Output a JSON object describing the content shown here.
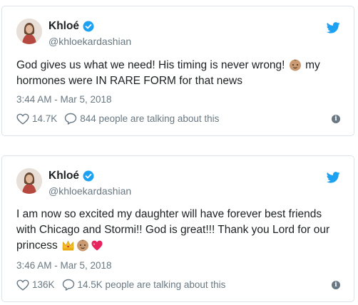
{
  "colors": {
    "verified_blue": "#1da1f2",
    "twitter_blue": "#1da1f2",
    "meta_gray": "#697882",
    "text": "#1c2022",
    "border": "#dde3e8"
  },
  "tweets": [
    {
      "display_name": "Khloé",
      "handle": "@khloekardashian",
      "text_parts": [
        "God gives us what we need! His timing is never wrong!",
        "my hormones were IN RARE FORM for that news"
      ],
      "emojis": [
        "baby-face-emoji"
      ],
      "timestamp": "3:44 AM - Mar 5, 2018",
      "likes": "14.7K",
      "talking": "844 people are talking about this"
    },
    {
      "display_name": "Khloé",
      "handle": "@khloekardashian",
      "text_parts": [
        "I am now so excited my daughter will have forever best friends with Chicago and Stormi!! God is great!!! Thank you Lord for our princess"
      ],
      "emojis": [
        "crown-emoji",
        "baby-face-emoji",
        "sparkling-heart-emoji"
      ],
      "timestamp": "3:46 AM - Mar 5, 2018",
      "likes": "136K",
      "talking": "14.5K people are talking about this"
    }
  ],
  "icons": {
    "verified": "verified-badge-icon",
    "brand": "twitter-bird-icon",
    "like": "heart-outline-icon",
    "reply": "speech-bubble-icon",
    "info": "info-icon"
  }
}
